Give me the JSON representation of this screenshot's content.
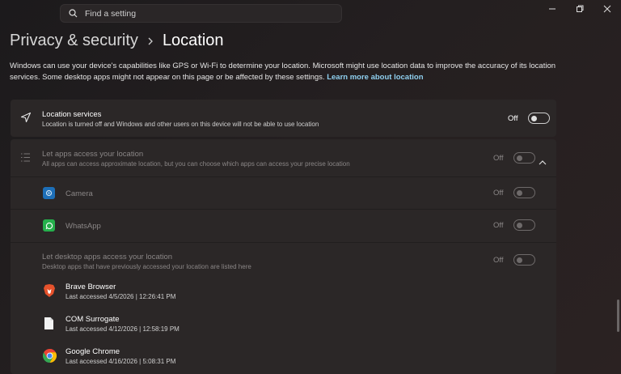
{
  "search": {
    "placeholder": "Find a setting"
  },
  "breadcrumb": {
    "parent": "Privacy & security",
    "current": "Location"
  },
  "description": {
    "text": "Windows can use your device's capabilities like GPS or Wi-Fi to determine your location. Microsoft might use location data to improve the accuracy of its location services. Some desktop apps might not appear on this page or be affected by these settings.",
    "link": "Learn more about location"
  },
  "location_services": {
    "title": "Location services",
    "subtitle": "Location is turned off and Windows and other users on this device will not be able to use location",
    "state": "Off"
  },
  "apps_access": {
    "title": "Let apps access your location",
    "subtitle": "All apps can access approximate location, but you can choose which apps can access your precise location",
    "state": "Off"
  },
  "apps": [
    {
      "name": "Camera",
      "state": "Off"
    },
    {
      "name": "WhatsApp",
      "state": "Off"
    }
  ],
  "desktop_access": {
    "title": "Let desktop apps access your location",
    "subtitle": "Desktop apps that have previously accessed your location are listed here",
    "state": "Off"
  },
  "desktop_apps": [
    {
      "name": "Brave Browser",
      "last": "Last accessed 4/5/2026  |  12:26:41 PM"
    },
    {
      "name": "COM Surrogate",
      "last": "Last accessed 4/12/2026  |  12:58:19 PM"
    },
    {
      "name": "Google Chrome",
      "last": "Last accessed 4/16/2026  |  5:08:31 PM"
    }
  ],
  "colors": {
    "link": "#8fd0f0",
    "background": "#221e1f",
    "card": "#2b2727"
  }
}
